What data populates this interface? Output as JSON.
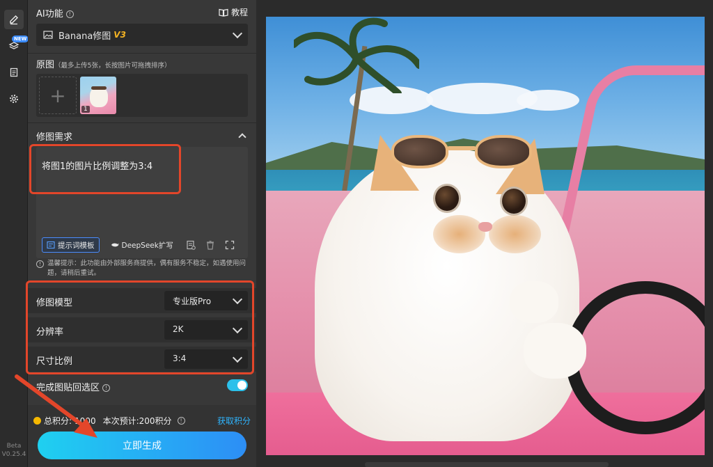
{
  "rail": {
    "new_badge": "NEW",
    "version_line1": "Beta",
    "version_line2": "V0.25.4"
  },
  "ai": {
    "title": "AI功能",
    "help": "!",
    "tutorial": "教程"
  },
  "model_select": {
    "name": "Banana修图",
    "version": "V3"
  },
  "source": {
    "title": "原图",
    "hint": "（最多上传5张，长按图片可拖拽排序）",
    "add": "+",
    "thumb_number": "1"
  },
  "requirement": {
    "title": "修图需求",
    "prompt": "将图1的图片比例调整为3:4",
    "template_btn": "提示词模板",
    "deepseek_btn": "DeepSeek扩写"
  },
  "notice": {
    "icon": "!",
    "text": "温馨提示：此功能由外部服务商提供，偶有服务不稳定，如遇使用问题，请稍后重试。"
  },
  "settings": [
    {
      "label": "修图模型",
      "value": "专业版Pro"
    },
    {
      "label": "分辨率",
      "value": "2K"
    },
    {
      "label": "尺寸比例",
      "value": "3:4"
    }
  ],
  "toggle": {
    "label": "完成图贴回选区",
    "help": "!",
    "enabled": true
  },
  "footer": {
    "points": "总积分:",
    "points_value": "1000",
    "estimate": "本次预计:200积分",
    "estimate_help": "!",
    "get_points": "获取积分",
    "generate": "立即生成"
  },
  "colors": {
    "accent": "#2fb5ff",
    "annotation": "#e3462a",
    "coin": "#f5b800"
  }
}
